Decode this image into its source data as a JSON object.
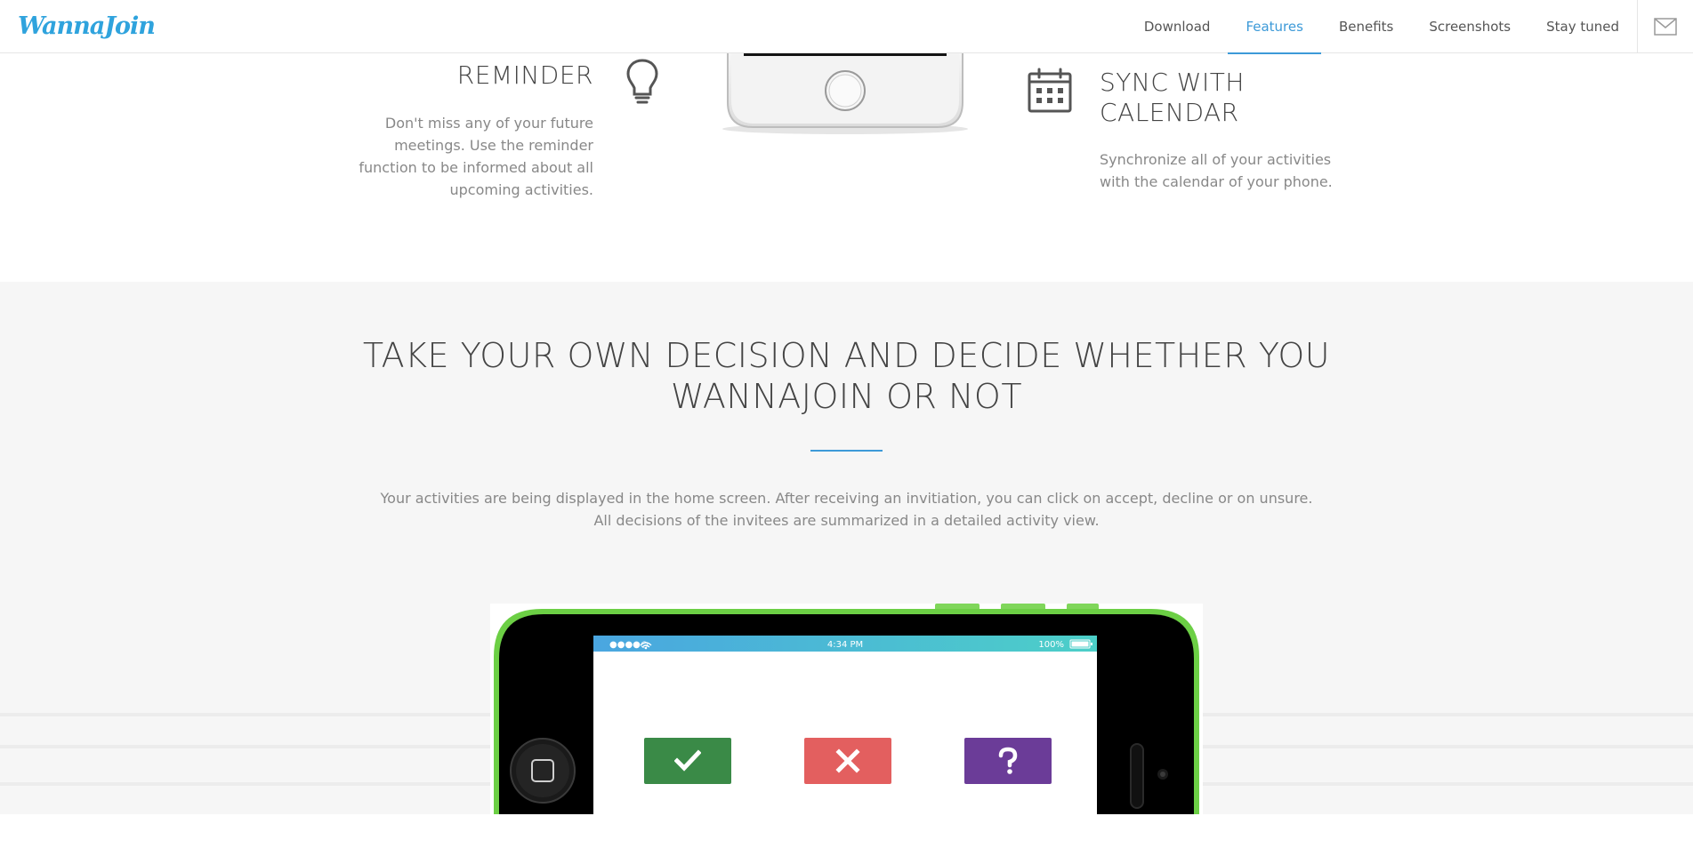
{
  "header": {
    "logo_text": "WannaJoin",
    "nav": [
      {
        "label": "Download"
      },
      {
        "label": "Features"
      },
      {
        "label": "Benefits"
      },
      {
        "label": "Screenshots"
      },
      {
        "label": "Stay tuned"
      }
    ],
    "active_nav": "Features",
    "mail_icon": "mail-icon"
  },
  "features": {
    "reminder": {
      "title": "REMINDER",
      "text": "Don't miss any of your future meetings. Use the reminder function to be informed about all upcoming activities.",
      "icon": "lightbulb-icon"
    },
    "sync": {
      "title_line1": "SYNC WITH",
      "title_line2": "CALENDAR",
      "text": "Synchronize all of your activities with the calendar of your phone.",
      "icon": "calendar-icon"
    }
  },
  "decision": {
    "title_line1": "TAKE YOUR OWN DECISION AND DECIDE WHETHER YOU",
    "title_line2": "WANNAJOIN OR NOT",
    "text_line1": "Your activities are being displayed in the home screen. After receiving an invitiation, you can click on accept, decline or on unsure.",
    "text_line2": "All decisions of the invitees are summarized in a detailed activity view.",
    "phone_status": {
      "time": "4:34 PM",
      "battery": "100%"
    },
    "buttons": [
      {
        "action": "accept",
        "icon": "checkmark-icon",
        "color": "#3a8a47"
      },
      {
        "action": "decline",
        "icon": "close-icon",
        "color": "#e35f5f"
      },
      {
        "action": "unsure",
        "icon": "question-icon",
        "color": "#6b3c98"
      }
    ]
  },
  "colors": {
    "accent": "#3d9ad8",
    "logo": "#2fa3dd",
    "section_bg": "#f6f6f6",
    "phone_green": "#6ccf45"
  }
}
